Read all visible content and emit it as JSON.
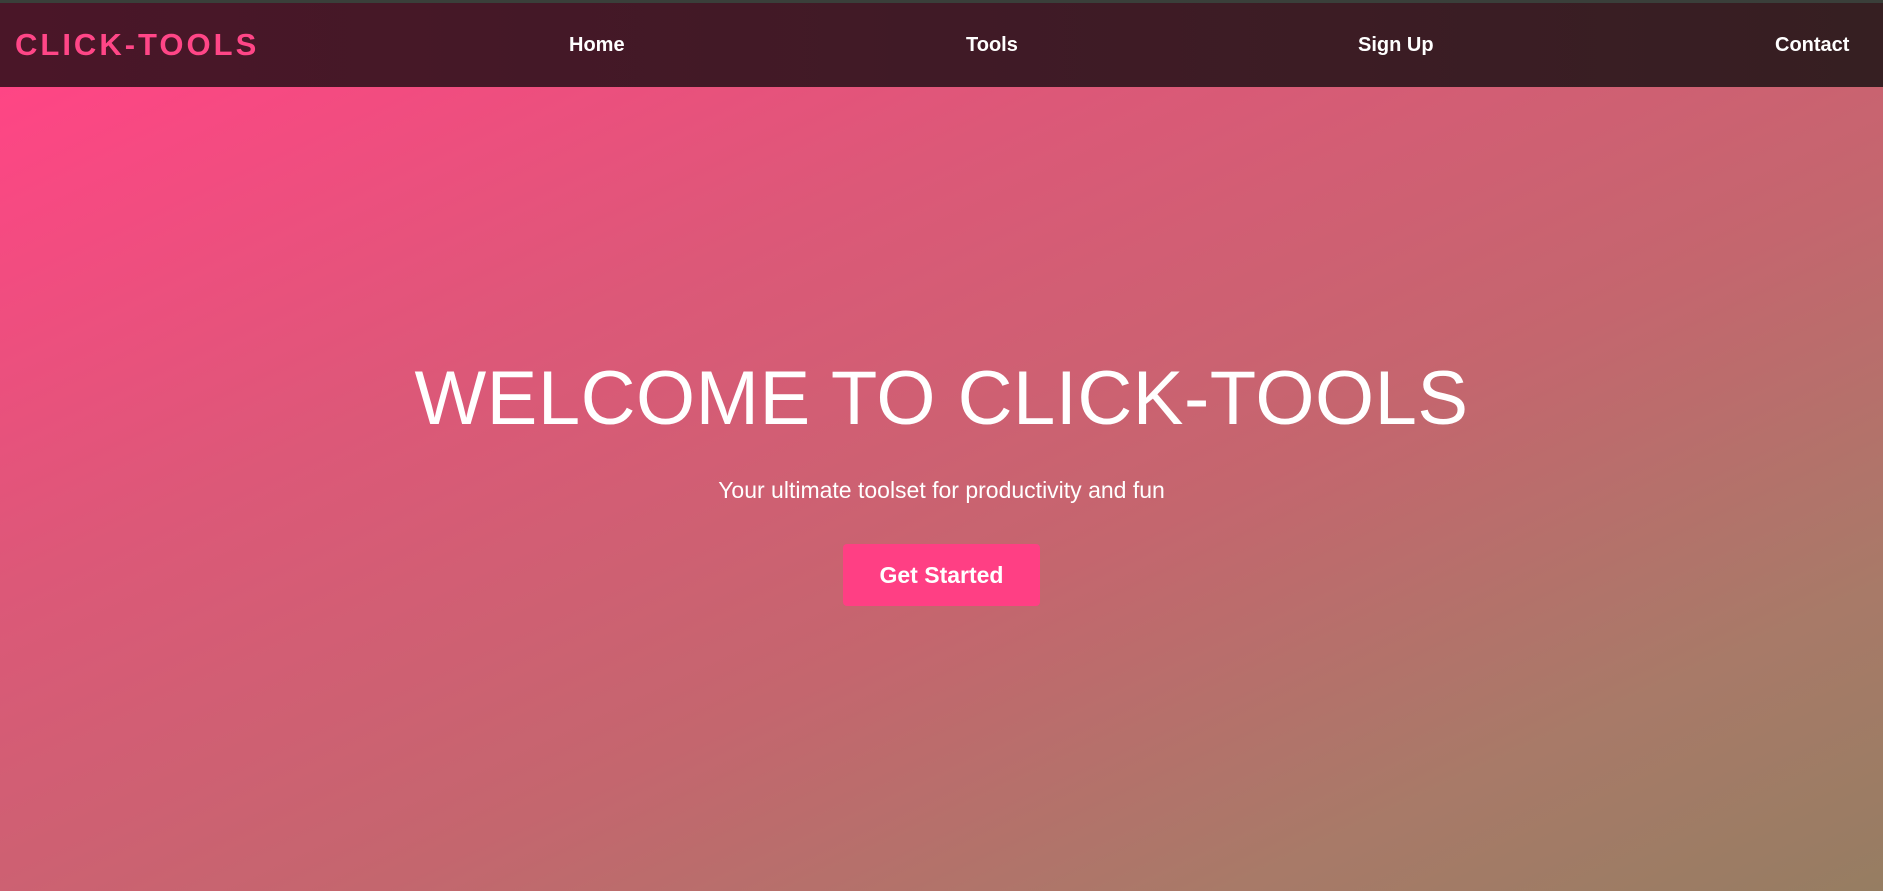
{
  "brand": {
    "logo_text": "CLICK-TOOLS",
    "logo_color": "#ff4687"
  },
  "nav": {
    "items": [
      {
        "label": "Home"
      },
      {
        "label": "Tools"
      },
      {
        "label": "Sign Up"
      },
      {
        "label": "Contact"
      }
    ]
  },
  "hero": {
    "title": "WELCOME TO CLICK-TOOLS",
    "subtitle": "Your ultimate toolset for productivity and fun",
    "cta_label": "Get Started",
    "cta_color": "#ff3f84",
    "gradient_colors": [
      "#ff4585",
      "#967d62"
    ]
  }
}
